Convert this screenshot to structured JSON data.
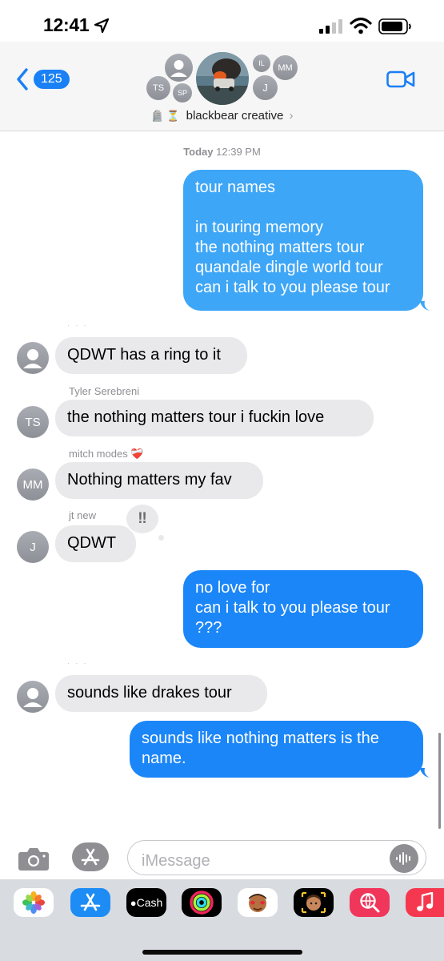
{
  "status_bar": {
    "time": "12:41"
  },
  "header": {
    "back_count": "125",
    "group_name": "blackbear creative",
    "group_emoji": "🪦 ⏳",
    "member_initials": {
      "ts": "TS",
      "sp": "SP",
      "il": "IL",
      "mm": "MM",
      "j": "J"
    }
  },
  "conversation": {
    "timestamp_day": "Today",
    "timestamp_time": "12:39 PM",
    "messages": [
      {
        "sender": "me",
        "lines": [
          "tour names",
          "",
          "in touring memory",
          "the nothing matters tour",
          "quandale dingle world tour",
          "can i talk to you please tour"
        ]
      },
      {
        "sender": "",
        "lines": [
          "QDWT has a ring to it"
        ]
      },
      {
        "sender": "Tyler Serebreni",
        "initials": "TS",
        "lines": [
          "the nothing matters tour i fuckin love"
        ]
      },
      {
        "sender": "mitch modes ❤️‍🩹",
        "initials": "MM",
        "lines": [
          "Nothing matters my fav"
        ]
      },
      {
        "sender": "jt new",
        "initials": "J",
        "lines": [
          "QDWT"
        ],
        "tapback": "‼"
      },
      {
        "sender": "me",
        "lines": [
          "no love for",
          "can i talk to you please tour",
          "???"
        ]
      },
      {
        "sender": "",
        "lines": [
          "sounds like drakes tour"
        ]
      },
      {
        "sender": "me",
        "lines": [
          "sounds like nothing matters is the",
          "name."
        ]
      }
    ]
  },
  "input": {
    "placeholder": "iMessage"
  },
  "app_drawer": {
    "apps": [
      {
        "name": "photos-app",
        "icon": "photos-icon"
      },
      {
        "name": "app-store-app",
        "icon": "app-store-icon"
      },
      {
        "name": "apple-cash-app",
        "icon": "cash-icon",
        "label": "Cash"
      },
      {
        "name": "fitness-app",
        "icon": "activity-rings-icon"
      },
      {
        "name": "memoji-stickers-app",
        "icon": "memoji-stickers-icon"
      },
      {
        "name": "memoji-app",
        "icon": "memoji-icon"
      },
      {
        "name": "web-images-app",
        "icon": "globe-search-icon"
      },
      {
        "name": "music-app",
        "icon": "music-note-icon"
      }
    ]
  },
  "colors": {
    "sent_bubble": "#1b86f8",
    "sent_bubble_light": "#3ea6f7",
    "received_bubble": "#e9e9eb",
    "accent": "#1a80f5"
  }
}
